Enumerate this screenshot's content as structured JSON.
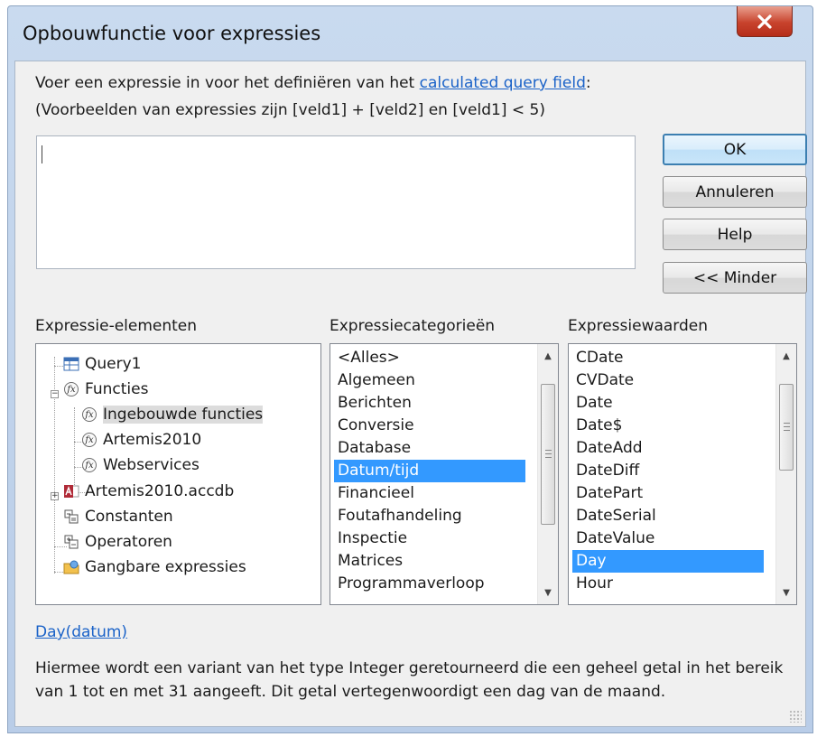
{
  "window": {
    "title": "Opbouwfunctie voor expressies",
    "close_icon": "close-icon"
  },
  "instructions": {
    "line1_prefix": "Voer een expressie in voor het definiëren van het ",
    "line1_link": "calculated query field",
    "line1_suffix": ":",
    "line2": "(Voorbeelden van expressies zijn [veld1] + [veld2] en [veld1] < 5)"
  },
  "expression": {
    "value": ""
  },
  "buttons": {
    "ok": "OK",
    "cancel": "Annuleren",
    "help": "Help",
    "less": "<< Minder"
  },
  "elements": {
    "label": "Expressie-elementen",
    "items": [
      {
        "label": "Query1",
        "icon": "query-icon"
      },
      {
        "label": "Functies",
        "icon": "function-icon"
      },
      {
        "label": "Ingebouwde functies",
        "icon": "function-icon"
      },
      {
        "label": "Artemis2010",
        "icon": "function-icon"
      },
      {
        "label": "Webservices",
        "icon": "function-icon"
      },
      {
        "label": "Artemis2010.accdb",
        "icon": "access-database-icon"
      },
      {
        "label": "Constanten",
        "icon": "constants-icon"
      },
      {
        "label": "Operatoren",
        "icon": "operators-icon"
      },
      {
        "label": "Gangbare expressies",
        "icon": "common-expressions-icon"
      }
    ]
  },
  "categories": {
    "label": "Expressiecategorieën",
    "items": [
      "<Alles>",
      "Algemeen",
      "Berichten",
      "Conversie",
      "Database",
      "Datum/tijd",
      "Financieel",
      "Foutafhandeling",
      "Inspectie",
      "Matrices",
      "Programmaverloop"
    ],
    "selected": "Datum/tijd"
  },
  "values": {
    "label": "Expressiewaarden",
    "items": [
      "CDate",
      "CVDate",
      "Date",
      "Date$",
      "DateAdd",
      "DateDiff",
      "DatePart",
      "DateSerial",
      "DateValue",
      "Day",
      "Hour"
    ],
    "selected": "Day"
  },
  "function": {
    "signature": "Day(datum)",
    "description": "Hiermee wordt een variant van het type Integer geretourneerd die een geheel getal in het bereik van 1 tot en met 31 aangeeft. Dit getal vertegenwoordigt een dag van de maand."
  },
  "colors": {
    "selection": "#3399ff",
    "link": "#1a62c8",
    "close_button": "#c8432d"
  }
}
